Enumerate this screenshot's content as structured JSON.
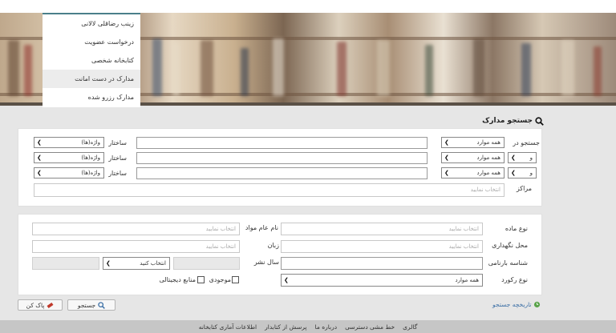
{
  "menu": {
    "items": [
      {
        "label": "زینب رضاقلی لالانی"
      },
      {
        "label": "درخواست عضویت"
      },
      {
        "label": "کتابخانه شخصی"
      },
      {
        "label": "مدارک در دست امانت"
      },
      {
        "label": "مدارک رزرو شده"
      }
    ]
  },
  "search": {
    "title": "جستجو مدارک",
    "search_in_label": "جستجو در",
    "structure_label": "ساختار",
    "centers_label": "مراکز",
    "centers_placeholder": "انتخاب نمایید",
    "rows": [
      {
        "operator": "",
        "field": "همه موارد",
        "query": "",
        "structure": "واژه(ها)"
      },
      {
        "operator": "و",
        "field": "همه موارد",
        "query": "",
        "structure": "واژه(ها)"
      },
      {
        "operator": "و",
        "field": "همه موارد",
        "query": "",
        "structure": "واژه(ها)"
      }
    ]
  },
  "filters": {
    "material_type_label": "نوع ماده",
    "material_type_placeholder": "انتخاب نمایید",
    "general_name_label": "نام عام مواد",
    "general_name_placeholder": "انتخاب نمایید",
    "location_label": "محل نگهداری",
    "location_placeholder": "انتخاب نمایید",
    "language_label": "زبان",
    "language_placeholder": "انتخاب نمایید",
    "barcode_label": "شناسه بارنامی",
    "pub_year_label": "سال نشر",
    "select_label": "انتخاب کنید",
    "record_type_label": "نوع رکورد",
    "record_type_value": "همه موارد",
    "availability_label": "موجودی",
    "digital_label": "منابع دیجیتالی"
  },
  "actions": {
    "search_button": "جستجو",
    "clear_button": "پاک کن",
    "history_link": "تاریخچه جستجو"
  },
  "footer": {
    "links": [
      "گالری",
      "خط مشی دسترسی",
      "درباره ما",
      "پرسش از کتابدار",
      "اطلاعات آماری کتابخانه"
    ]
  },
  "colors": {
    "accent": "#3a6ea5",
    "menu_border": "#4a7f8a"
  }
}
